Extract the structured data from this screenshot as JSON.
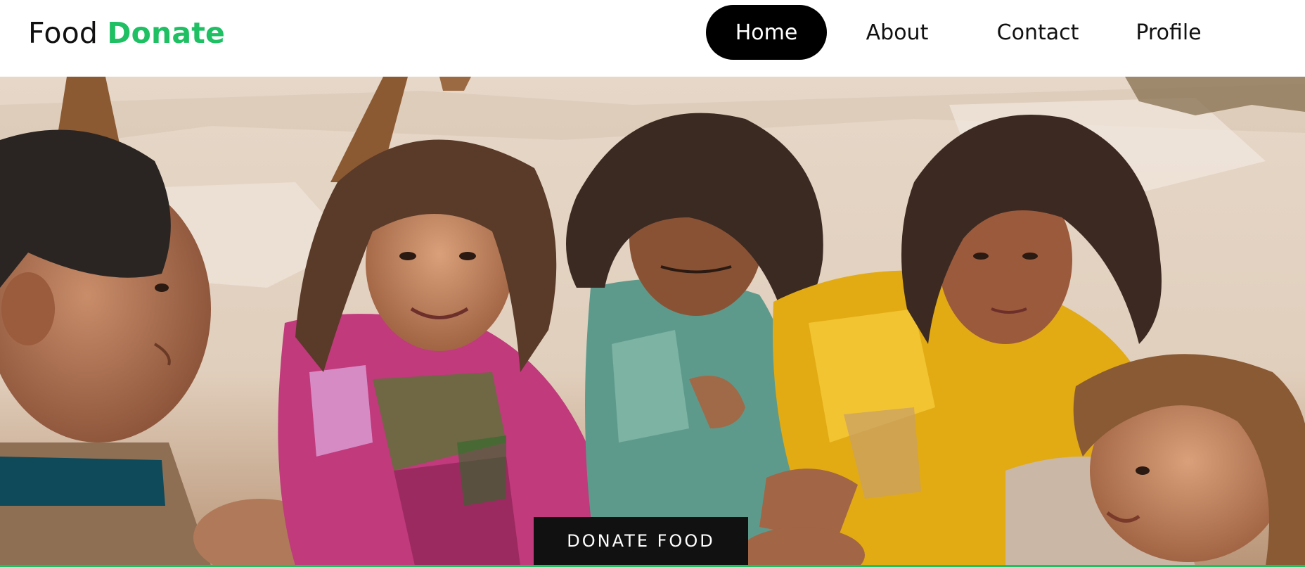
{
  "brand": {
    "name_part1": "Food ",
    "name_part2": "Donate",
    "accent_color": "#1fbf63"
  },
  "nav": {
    "items": [
      {
        "label": "Home",
        "active": true
      },
      {
        "label": "About",
        "active": false
      },
      {
        "label": "Contact",
        "active": false
      },
      {
        "label": "Profile",
        "active": false
      }
    ]
  },
  "hero": {
    "image_icon": "photo-icon",
    "cta_label": "DONATE FOOD"
  },
  "colors": {
    "nav_active_bg": "#000000",
    "cta_bg": "#111111",
    "divider": "#1fbf63"
  }
}
